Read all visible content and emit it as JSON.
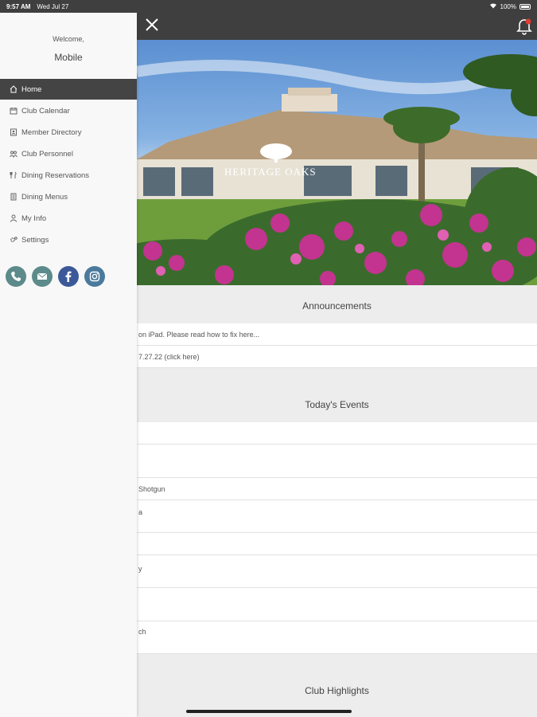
{
  "status_bar": {
    "time": "9:57 AM",
    "date": "Wed Jul 27",
    "battery": "100%"
  },
  "menu": {
    "welcome": "Welcome,",
    "user_name": "Mobile",
    "items": [
      {
        "label": "Home",
        "icon": "home-icon",
        "active": true
      },
      {
        "label": "Club Calendar",
        "icon": "calendar-icon"
      },
      {
        "label": "Member Directory",
        "icon": "directory-icon"
      },
      {
        "label": "Club Personnel",
        "icon": "personnel-icon"
      },
      {
        "label": "Dining Reservations",
        "icon": "dining-icon"
      },
      {
        "label": "Dining Menus",
        "icon": "menu-book-icon"
      },
      {
        "label": "My Info",
        "icon": "user-icon"
      },
      {
        "label": "Settings",
        "icon": "gear-icon"
      }
    ],
    "social": [
      "phone-icon",
      "email-icon",
      "facebook-icon",
      "instagram-icon"
    ]
  },
  "hero": {
    "logo_text": "HERITAGE OAKS"
  },
  "announcements": {
    "title": "Announcements",
    "items": [
      "on iPad. Please read how to fix here...",
      "7.27.22 (click here)"
    ]
  },
  "events": {
    "title": "Today's Events",
    "items": [
      "",
      "",
      "Shotgun",
      "a",
      "",
      "y",
      "",
      "ch"
    ]
  },
  "highlights": {
    "title": "Club Highlights"
  },
  "colors": {
    "header": "#3f3f3f",
    "menu_active": "#444444",
    "section_bg": "#ededed",
    "social_bg": "#5d8a8a",
    "facebook": "#3b5998"
  }
}
